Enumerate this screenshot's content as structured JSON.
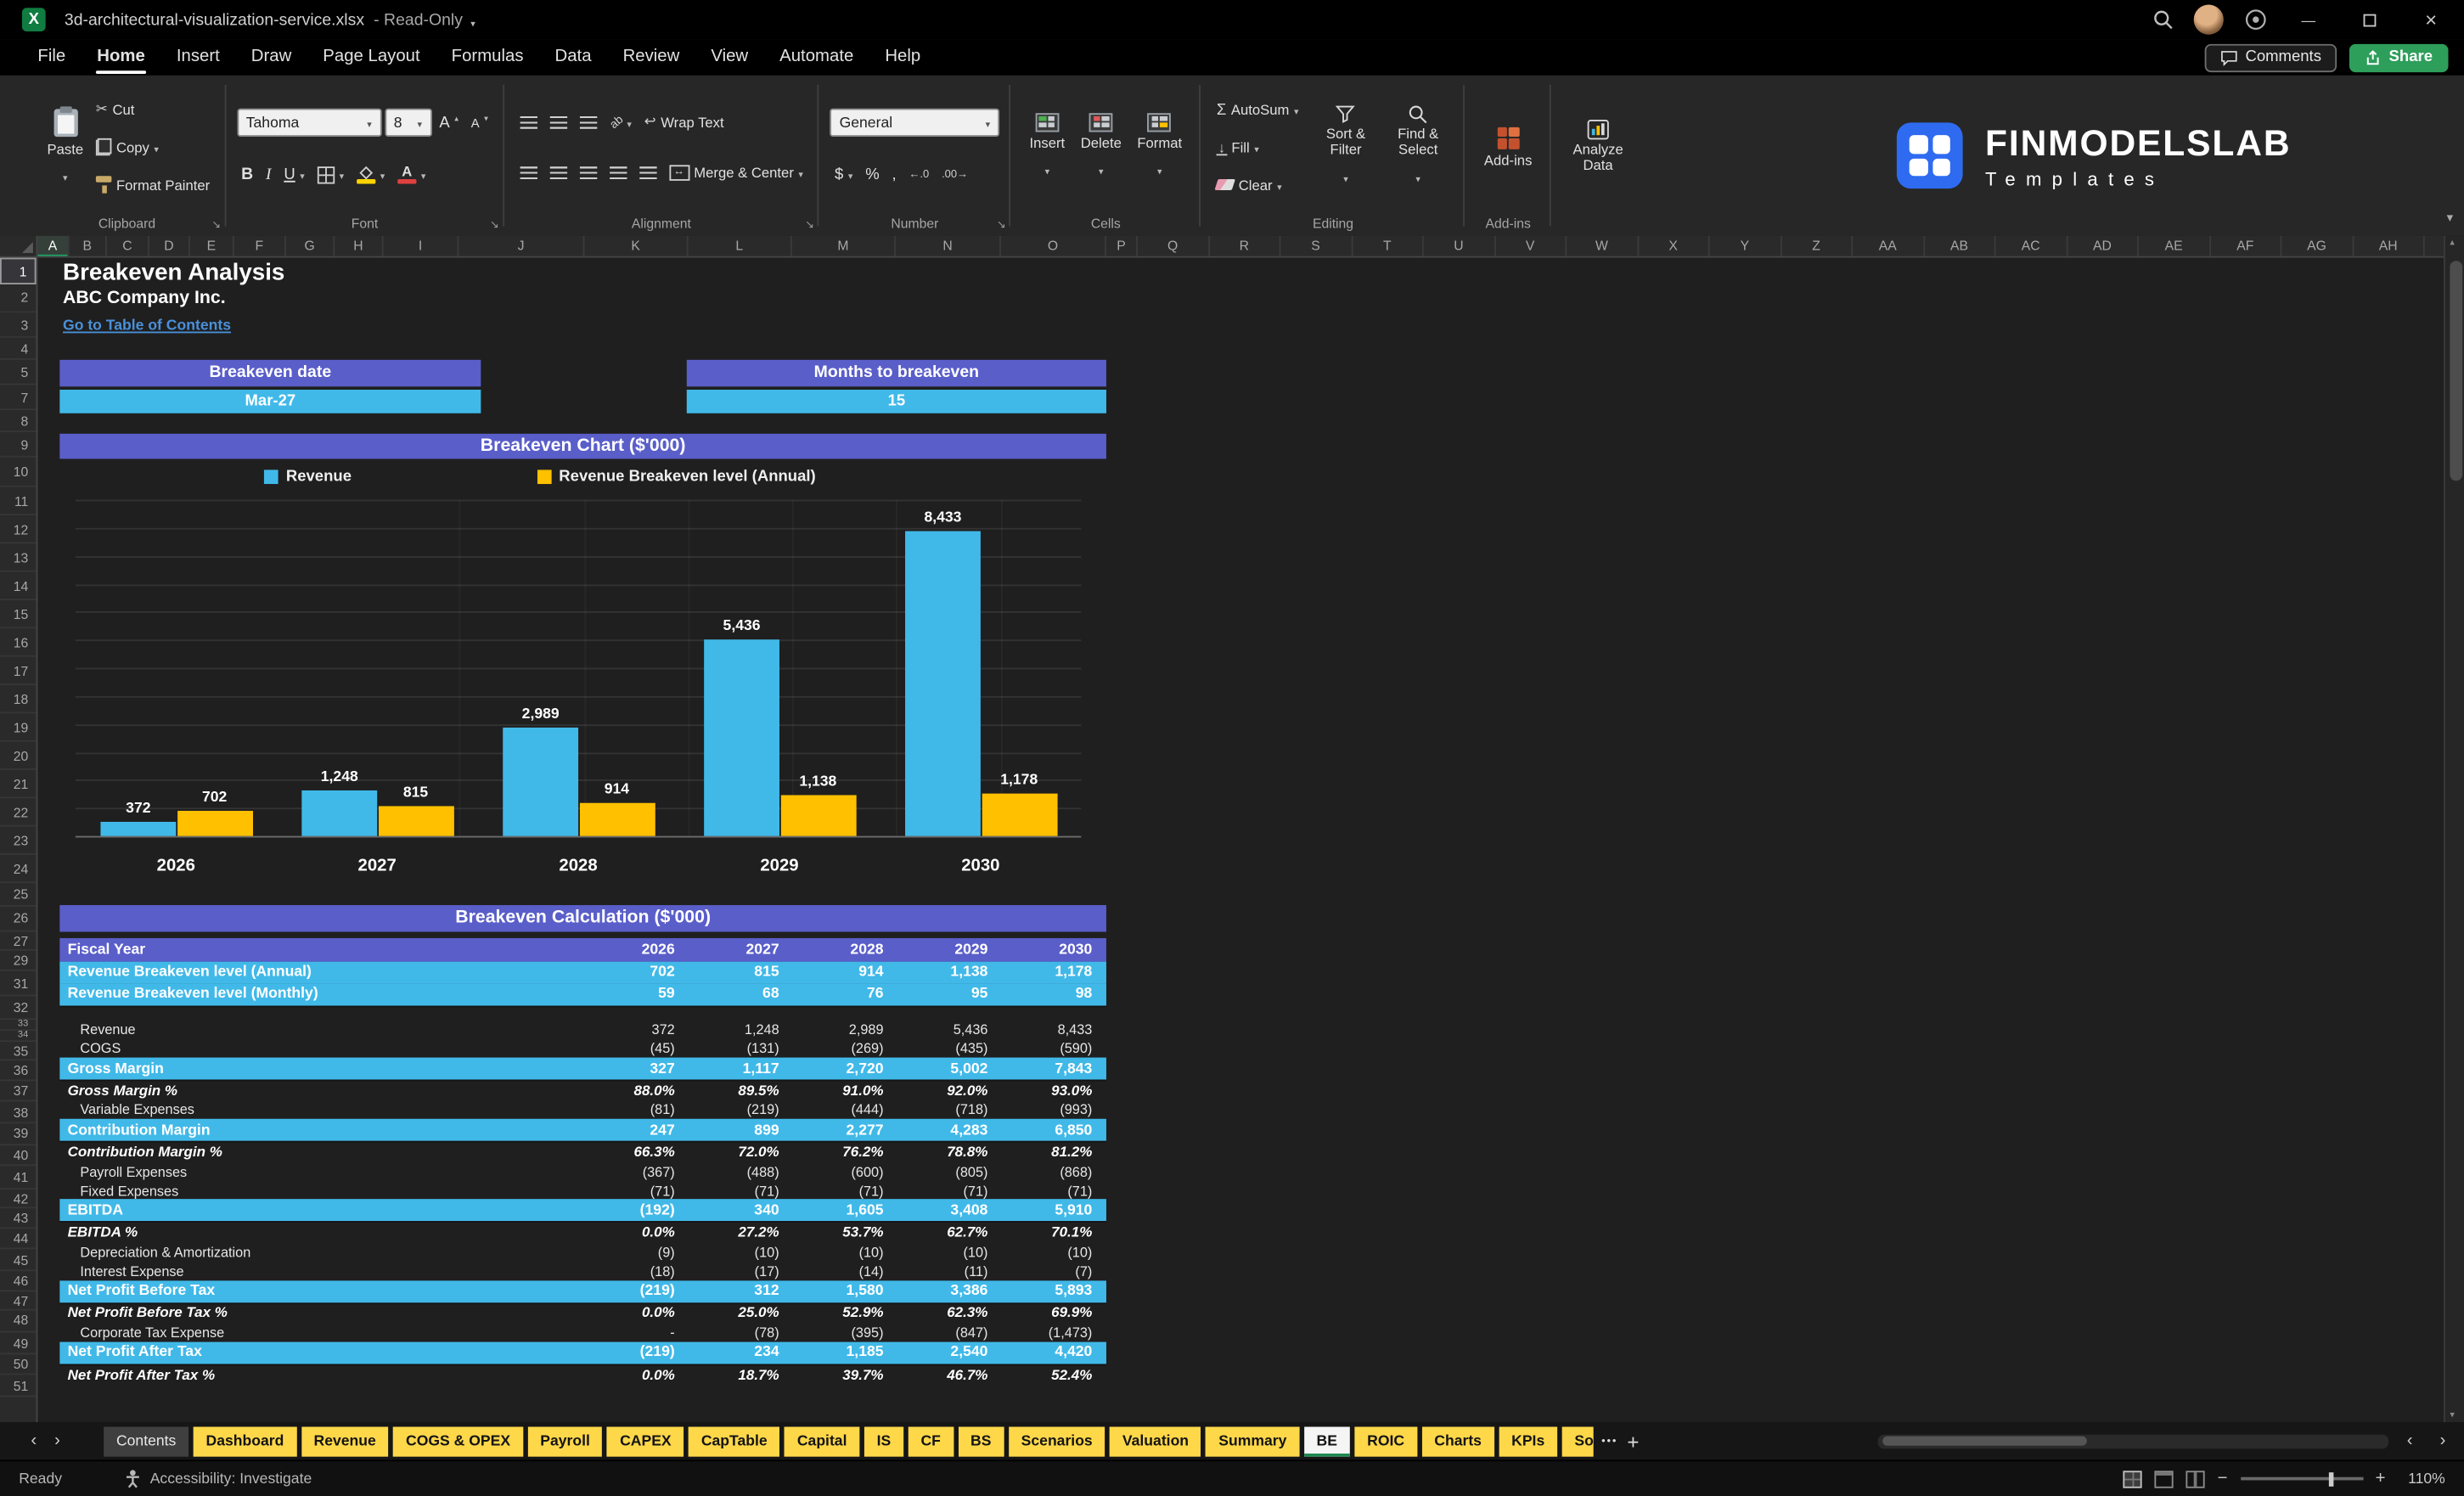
{
  "colors": {
    "header_purple": "#5A5EC9",
    "highlight_cyan": "#41B9E8",
    "bar_blue": "#41B9E8",
    "bar_gold": "#FFC000",
    "tab_yellow": "#FFD84A",
    "share_green": "#2E9E5B",
    "link_blue": "#4A90D9",
    "excel_green": "#107C41",
    "logo_blue": "#2E6BF0"
  },
  "titlebar": {
    "filename": "3d-architectural-visualization-service.xlsx",
    "separator": "-",
    "mode": "Read-Only"
  },
  "menubar": {
    "items": [
      "File",
      "Home",
      "Insert",
      "Draw",
      "Page Layout",
      "Formulas",
      "Data",
      "Review",
      "View",
      "Automate",
      "Help"
    ],
    "active": "Home",
    "comments": "Comments",
    "share": "Share"
  },
  "ribbon": {
    "paste": "Paste",
    "cut": "Cut",
    "copy": "Copy",
    "format_painter": "Format Painter",
    "clipboard_group": "Clipboard",
    "font_name": "Tahoma",
    "font_size": "8",
    "bold": "B",
    "italic": "I",
    "underline": "U",
    "font_group": "Font",
    "wrap_text": "Wrap Text",
    "merge_center": "Merge & Center",
    "alignment_group": "Alignment",
    "number_format": "General",
    "dollar": "$",
    "percent": "%",
    "comma": ",",
    "dec_left": "←.0",
    "dec_right": ".00→",
    "number_group": "Number",
    "insert": "Insert",
    "delete": "Delete",
    "format": "Format",
    "cells_group": "Cells",
    "autosum": "AutoSum",
    "fill": "Fill",
    "clear": "Clear",
    "sort_filter": "Sort & Filter",
    "find_select": "Find & Select",
    "editing_group": "Editing",
    "addins": "Add-ins",
    "addins_group": "Add-ins",
    "analyze_data": "Analyze Data",
    "brand": "FINMODELSLAB",
    "brand_sub": "Templates"
  },
  "grid": {
    "columns": [
      "A",
      "B",
      "C",
      "D",
      "E",
      "F",
      "G",
      "H",
      "I",
      "J",
      "K",
      "L",
      "M",
      "N",
      "O",
      "P",
      "Q",
      "R",
      "S",
      "T",
      "U",
      "V",
      "W",
      "X",
      "Y",
      "Z",
      "AA",
      "AB",
      "AC",
      "AD",
      "AE",
      "AF",
      "AG",
      "AH"
    ],
    "rows": [
      "1",
      "2",
      "3",
      "4",
      "5",
      "7",
      "8",
      "9",
      "10",
      "11",
      "12",
      "13",
      "14",
      "15",
      "16",
      "17",
      "18",
      "19",
      "20",
      "21",
      "22",
      "23",
      "24",
      "25",
      "26",
      "27",
      "29",
      "31",
      "32",
      "33",
      "34",
      "35",
      "36",
      "37",
      "38",
      "39",
      "40",
      "41",
      "42",
      "43",
      "44",
      "45",
      "46",
      "47",
      "48",
      "49",
      "50",
      "51"
    ]
  },
  "sheet": {
    "title": "Breakeven Analysis",
    "company": "ABC Company Inc.",
    "toc_link": "Go to Table of Contents",
    "breakeven_date_label": "Breakeven date",
    "breakeven_date_value": "Mar-27",
    "months_label": "Months to breakeven",
    "months_value": "15",
    "chart_title": "Breakeven Chart ($'000)",
    "calc_title": "Breakeven Calculation ($'000)"
  },
  "chart_data": {
    "type": "bar",
    "title": "Breakeven Chart ($'000)",
    "categories": [
      "2026",
      "2027",
      "2028",
      "2029",
      "2030"
    ],
    "series": [
      {
        "name": "Revenue",
        "color": "#41B9E8",
        "values": [
          372,
          1248,
          2989,
          5436,
          8433
        ],
        "labels": [
          "372",
          "1,248",
          "2,989",
          "5,436",
          "8,433"
        ]
      },
      {
        "name": "Revenue Breakeven level (Annual)",
        "color": "#FFC000",
        "values": [
          702,
          815,
          914,
          1138,
          1178
        ],
        "labels": [
          "702",
          "815",
          "914",
          "1,138",
          "1,178"
        ]
      }
    ],
    "xlabel": "",
    "ylabel": "",
    "ylim": [
      0,
      9300
    ],
    "grid": true,
    "legend_position": "top"
  },
  "table": {
    "header": [
      "Fiscal Year",
      "2026",
      "2027",
      "2028",
      "2029",
      "2030"
    ],
    "rows": [
      {
        "label": "Revenue Breakeven level (Annual)",
        "values": [
          "702",
          "815",
          "914",
          "1,138",
          "1,178"
        ],
        "style": "highlight"
      },
      {
        "label": "Revenue Breakeven level (Monthly)",
        "values": [
          "59",
          "68",
          "76",
          "95",
          "98"
        ],
        "style": "highlight"
      },
      {
        "label": "",
        "values": [
          "",
          "",
          "",
          "",
          ""
        ],
        "style": "spacer"
      },
      {
        "label": "Revenue",
        "values": [
          "372",
          "1,248",
          "2,989",
          "5,436",
          "8,433"
        ],
        "style": "plain"
      },
      {
        "label": "COGS",
        "values": [
          "(45)",
          "(131)",
          "(269)",
          "(435)",
          "(590)"
        ],
        "style": "plain"
      },
      {
        "label": "Gross Margin",
        "values": [
          "327",
          "1,117",
          "2,720",
          "5,002",
          "7,843"
        ],
        "style": "highlight"
      },
      {
        "label": "Gross Margin %",
        "values": [
          "88.0%",
          "89.5%",
          "91.0%",
          "92.0%",
          "93.0%"
        ],
        "style": "percent"
      },
      {
        "label": "Variable Expenses",
        "values": [
          "(81)",
          "(219)",
          "(444)",
          "(718)",
          "(993)"
        ],
        "style": "plain"
      },
      {
        "label": "Contribution Margin",
        "values": [
          "247",
          "899",
          "2,277",
          "4,283",
          "6,850"
        ],
        "style": "highlight"
      },
      {
        "label": "Contribution Margin %",
        "values": [
          "66.3%",
          "72.0%",
          "76.2%",
          "78.8%",
          "81.2%"
        ],
        "style": "percent"
      },
      {
        "label": "Payroll Expenses",
        "values": [
          "(367)",
          "(488)",
          "(600)",
          "(805)",
          "(868)"
        ],
        "style": "plain"
      },
      {
        "label": "Fixed Expenses",
        "values": [
          "(71)",
          "(71)",
          "(71)",
          "(71)",
          "(71)"
        ],
        "style": "plain"
      },
      {
        "label": "EBITDA",
        "values": [
          "(192)",
          "340",
          "1,605",
          "3,408",
          "5,910"
        ],
        "style": "highlight"
      },
      {
        "label": "EBITDA %",
        "values": [
          "0.0%",
          "27.2%",
          "53.7%",
          "62.7%",
          "70.1%"
        ],
        "style": "percent"
      },
      {
        "label": "Depreciation & Amortization",
        "values": [
          "(9)",
          "(10)",
          "(10)",
          "(10)",
          "(10)"
        ],
        "style": "plain"
      },
      {
        "label": "Interest Expense",
        "values": [
          "(18)",
          "(17)",
          "(14)",
          "(11)",
          "(7)"
        ],
        "style": "plain"
      },
      {
        "label": "Net Profit Before Tax",
        "values": [
          "(219)",
          "312",
          "1,580",
          "3,386",
          "5,893"
        ],
        "style": "highlight"
      },
      {
        "label": "Net Profit Before Tax %",
        "values": [
          "0.0%",
          "25.0%",
          "52.9%",
          "62.3%",
          "69.9%"
        ],
        "style": "percent"
      },
      {
        "label": "Corporate Tax Expense",
        "values": [
          "-",
          "(78)",
          "(395)",
          "(847)",
          "(1,473)"
        ],
        "style": "plain"
      },
      {
        "label": "Net Profit After Tax",
        "values": [
          "(219)",
          "234",
          "1,185",
          "2,540",
          "4,420"
        ],
        "style": "highlight"
      },
      {
        "label": "Net Profit After Tax %",
        "values": [
          "0.0%",
          "18.7%",
          "39.7%",
          "46.7%",
          "52.4%"
        ],
        "style": "percent"
      }
    ]
  },
  "tabs": {
    "items": [
      {
        "label": "Contents",
        "style": "gray"
      },
      {
        "label": "Dashboard",
        "style": "yellow"
      },
      {
        "label": "Revenue",
        "style": "yellow"
      },
      {
        "label": "COGS & OPEX",
        "style": "yellow"
      },
      {
        "label": "Payroll",
        "style": "yellow"
      },
      {
        "label": "CAPEX",
        "style": "yellow"
      },
      {
        "label": "CapTable",
        "style": "yellow"
      },
      {
        "label": "Capital",
        "style": "yellow"
      },
      {
        "label": "IS",
        "style": "yellow"
      },
      {
        "label": "CF",
        "style": "yellow"
      },
      {
        "label": "BS",
        "style": "yellow"
      },
      {
        "label": "Scenarios",
        "style": "yellow"
      },
      {
        "label": "Valuation",
        "style": "yellow"
      },
      {
        "label": "Summary",
        "style": "yellow"
      },
      {
        "label": "BE",
        "style": "active"
      },
      {
        "label": "ROIC",
        "style": "yellow"
      },
      {
        "label": "Charts",
        "style": "yellow"
      },
      {
        "label": "KPIs",
        "style": "yellow"
      },
      {
        "label": "So",
        "style": "yellow",
        "truncated": true
      }
    ],
    "more_label": "•••"
  },
  "statusbar": {
    "ready": "Ready",
    "accessibility": "Accessibility: Investigate",
    "zoom": "110%"
  }
}
